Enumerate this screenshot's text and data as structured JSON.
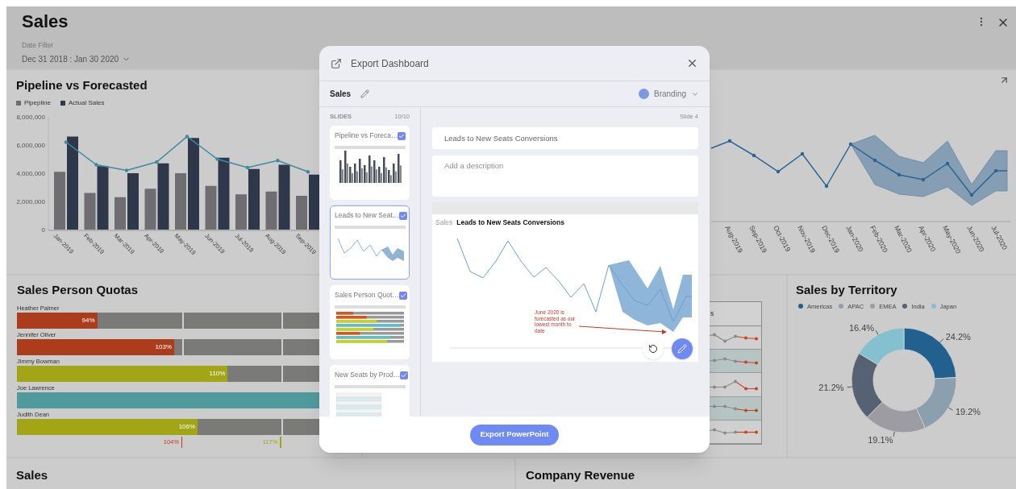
{
  "dashboard": {
    "title": "Sales",
    "date_filter": {
      "label": "Date Filter",
      "value": "Dec 31 2018 : Jan 30 2020"
    }
  },
  "pipeline": {
    "title": "Pipeline vs Forecasted",
    "chart_data": {
      "type": "bar",
      "categories": [
        "Jan-2019",
        "Feb-2019",
        "Mar-2019",
        "Apr-2019",
        "May-2019",
        "Jun-2019",
        "Jul-2019",
        "Aug-2019",
        "Sep-2019"
      ],
      "stacked": false,
      "series": [
        {
          "name": "Pipepline",
          "type": "bar",
          "color": "#6e6e72",
          "values": [
            4100000,
            2600000,
            2300000,
            2900000,
            4000000,
            3100000,
            2500000,
            2700000,
            2400000
          ]
        },
        {
          "name": "Actual Sales",
          "type": "bar",
          "color": "#2f384b",
          "values": [
            6600000,
            4500000,
            4000000,
            4700000,
            6500000,
            5100000,
            4300000,
            4600000,
            3900000
          ]
        },
        {
          "type": "line",
          "color": "#3f8a9e",
          "values": [
            6200000,
            4600000,
            4200000,
            4800000,
            6600000,
            5000000,
            4400000,
            4900000,
            4100000
          ]
        }
      ],
      "ylim": [
        0,
        8000000
      ],
      "yticks": [
        {
          "value": 0,
          "label": "0"
        },
        {
          "value": 2000000,
          "label": "2,000,000"
        },
        {
          "value": 4000000,
          "label": "4,000,000"
        },
        {
          "value": 6000000,
          "label": "6,000,000"
        },
        {
          "value": 8000000,
          "label": "8,000,000"
        }
      ]
    }
  },
  "leads_chart": {
    "x_labels": [
      "Aug-2019",
      "Sep-2019",
      "Oct-2019",
      "Nov-2019",
      "Dec-2019",
      "Jan-2020",
      "Feb-2020",
      "Mar-2020",
      "Apr-2020",
      "May-2020",
      "Jun-2020",
      "Jul-2020"
    ]
  },
  "quotas": {
    "title": "Sales Person Quotas",
    "rows": [
      {
        "name": "Heather Palmer",
        "value_label": "94%",
        "level": 0.24,
        "color": "#ac3d1c"
      },
      {
        "name": "Jennifer Oliver",
        "value_label": "103%",
        "level": 0.47,
        "color": "#ac3d1c"
      },
      {
        "name": "Jimmy Bowman",
        "value_label": "110%",
        "level": 0.63,
        "color": "#a1a516"
      },
      {
        "name": "Joe Lawrence",
        "level": 1,
        "color": "#4e9a9c"
      },
      {
        "name": "Judith Dean",
        "value_label": "106%",
        "level": 0.54,
        "color": "#a1a516"
      }
    ],
    "targets": [
      {
        "label": "104%",
        "color": "#c0392b"
      },
      {
        "label": "117%",
        "color": "#a1a516"
      }
    ]
  },
  "product_table": {
    "column_1": "s"
  },
  "territory": {
    "title": "Sales by Territory",
    "legend": [
      {
        "color": "#21608f"
      },
      {
        "color": "#8c9faf"
      },
      {
        "color": "#9c9ca2"
      },
      {
        "color": "#576174"
      },
      {
        "color": "#84c0cf"
      }
    ],
    "chart_data": {
      "type": "donut",
      "categories": [
        "Americas",
        "APAC",
        "EMEA",
        "India",
        "Japan"
      ],
      "values": [
        24.2,
        19.2,
        19.1,
        21.2,
        16.4
      ],
      "value_labels": [
        "24.2%",
        "19.2%",
        "19.1%",
        "21.2%",
        "16.4%"
      ]
    }
  },
  "bottom_panels": [
    {
      "title": "Sales"
    },
    {
      "title": "Company Revenue"
    }
  ],
  "export_dialog": {
    "title": "Export Dashboard",
    "dashboard_name": "Sales",
    "branding": {
      "label": "Branding",
      "color": "#7b9ae0"
    },
    "slides_label": "SLIDES",
    "slides_count": "10/10",
    "slides": [
      {
        "title": "Pipeline vs Foreca…",
        "checked": true,
        "selected": false,
        "kind": "bar"
      },
      {
        "title": "Leads to New Seat…",
        "checked": true,
        "selected": true,
        "kind": "line"
      },
      {
        "title": "Sales Person Quot…",
        "checked": true,
        "selected": false,
        "kind": "quota"
      },
      {
        "title": "New Seats by Prod…",
        "checked": true,
        "selected": false,
        "kind": "table"
      }
    ],
    "slide_number": "Slide 4",
    "slide_title": "Leads to New Seats Conversions",
    "description_placeholder": "Add a description",
    "preview": {
      "dashboard": "Sales",
      "title": "Leads to New Seats Conversions",
      "annotation": "June 2020 is forecasted as our lowest month to date"
    },
    "export_button": "Export PowerPoint"
  }
}
